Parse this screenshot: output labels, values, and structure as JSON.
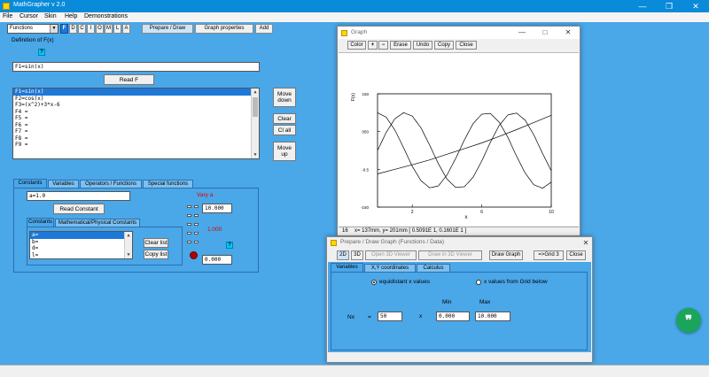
{
  "app": {
    "title": "MathGrapher v 2.0",
    "minimize": "—",
    "maximize": "❐",
    "close": "✕"
  },
  "menu": [
    "File",
    "Cursor",
    "Skin",
    "Help",
    "Demonstrations"
  ],
  "toolbar": {
    "mode": "Functions",
    "letters": [
      "F",
      "D",
      "C",
      "I",
      "O",
      "M",
      "L",
      "A"
    ],
    "prepare_draw": "Prepare / Draw",
    "graph_properties": "Graph properties",
    "add": "Add"
  },
  "definition": {
    "label": "Definition of F(x)",
    "help": "?",
    "value": "F1=sin(x)",
    "read_f": "Read F",
    "functions": [
      "F1=sin(x)",
      "F2=cos(x)",
      "F3=(x^2)+3*x-6",
      "F4 =",
      "F5 =",
      "F6 =",
      "F7 =",
      "F8 =",
      "F9 ="
    ],
    "move_down": "Move down",
    "clear": "Clear",
    "cl_all": "Cl all",
    "move_up": "Move up"
  },
  "constants_panel": {
    "tabs": [
      "Constants",
      "Variables",
      "Operators / Functions",
      "Special functions"
    ],
    "input": "a=1.0",
    "read_constant": "Read Constant",
    "subtabs": [
      "Constants",
      "Mathematical/Physical Constants"
    ],
    "list": [
      "a=",
      "b=",
      "d=",
      "l="
    ],
    "clear_list": "Clear list",
    "copy_list": "Copy list",
    "vary": "Vary a",
    "max": "10.000",
    "current": "1.000",
    "min": "0.000",
    "help": "?"
  },
  "graph_window": {
    "title": "Graph",
    "toolbar": [
      "Color",
      "+",
      "−",
      "Erase",
      "Undo",
      "Copy",
      "Close"
    ],
    "status_num": "16",
    "status": "x= 137mm, y= 201mm  [ 0.5091E 1,  0.1601E 1 ]"
  },
  "chart_data": {
    "type": "line",
    "xlabel": "x",
    "ylabel": "F(x)",
    "xlim": [
      0,
      10
    ],
    "ylim": [
      -1.5,
      1.5
    ],
    "xticks": [
      2,
      6,
      10
    ],
    "xtick_labels": [
      "2",
      "6",
      "10"
    ],
    "yticks": [
      -1.5,
      -0.5,
      0.5,
      1.5
    ],
    "ytick_labels": [
      "-150",
      "-0.5",
      "050",
      "150"
    ],
    "grid": false,
    "series": [
      {
        "x": [
          0,
          0.5,
          1,
          1.5,
          2,
          2.5,
          3,
          3.5,
          4,
          4.5,
          5,
          5.5,
          6,
          6.5,
          7,
          7.5,
          8,
          8.5,
          9,
          9.5,
          10
        ],
        "values": [
          0,
          0.48,
          0.84,
          1.0,
          0.91,
          0.6,
          0.14,
          -0.35,
          -0.76,
          -0.98,
          -0.96,
          -0.71,
          -0.28,
          0.22,
          0.66,
          0.94,
          0.99,
          0.8,
          0.41,
          -0.08,
          -0.54
        ]
      },
      {
        "x": [
          0,
          0.5,
          1,
          1.5,
          2,
          2.5,
          3,
          3.5,
          4,
          4.5,
          5,
          5.5,
          6,
          6.5,
          7,
          7.5,
          8,
          8.5,
          9,
          9.5,
          10
        ],
        "values": [
          1.0,
          0.88,
          0.54,
          0.07,
          -0.42,
          -0.8,
          -0.99,
          -0.94,
          -0.65,
          -0.21,
          0.28,
          0.71,
          0.96,
          0.98,
          0.75,
          0.35,
          -0.15,
          -0.6,
          -0.91,
          -1.0,
          -0.84
        ]
      },
      {
        "x": [
          0,
          1,
          2,
          3,
          4,
          5,
          6,
          7,
          8,
          9,
          10
        ],
        "values": [
          -0.62,
          -0.5,
          -0.38,
          -0.25,
          -0.1,
          0.05,
          0.2,
          0.37,
          0.55,
          0.74,
          0.93
        ]
      }
    ]
  },
  "prepare_window": {
    "title": "Prepare / Draw Graph (Functions / Data)",
    "toolbar": [
      "2D",
      "3D",
      "Open 3D Viewer",
      "Draw in 3D Viewer",
      "Draw Graph",
      "=>Grid 3",
      "Close"
    ],
    "tabs": [
      "Variables",
      "X,Y coordinates",
      "Calculus"
    ],
    "radio_equidistant": "equidistant x values",
    "radio_grid": "x values from Grid below",
    "min_label": "Min",
    "max_label": "Max",
    "nx_label": "Nx",
    "equals": "=",
    "nx": "50",
    "x_label": "x",
    "min": "0.000",
    "max": "10.000"
  },
  "fab": "❞"
}
